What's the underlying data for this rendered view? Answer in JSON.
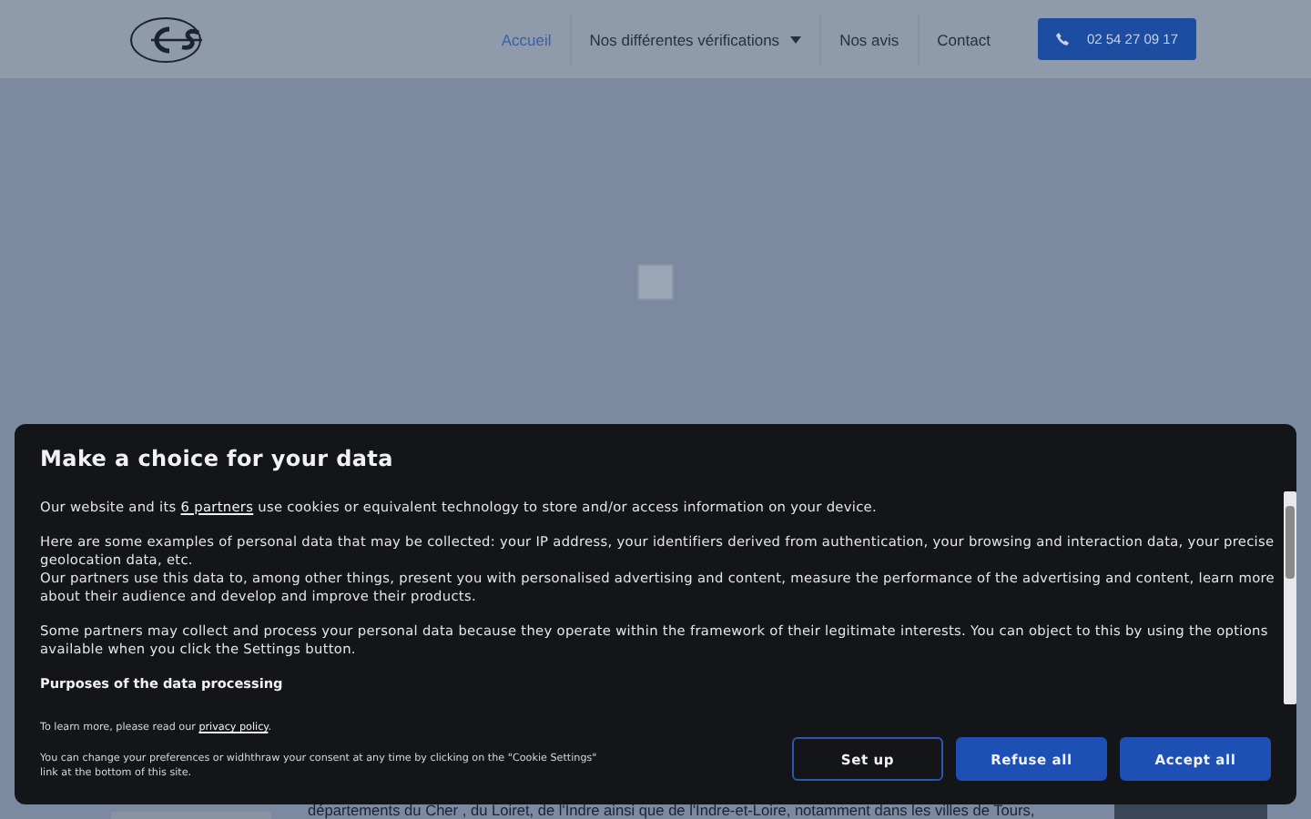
{
  "header": {
    "nav": [
      {
        "label": "Accueil",
        "selected": true,
        "dropdown": false
      },
      {
        "label": "Nos différentes vérifications",
        "selected": false,
        "dropdown": true
      },
      {
        "label": "Nos avis",
        "selected": false,
        "dropdown": false
      },
      {
        "label": "Contact",
        "selected": false,
        "dropdown": false
      }
    ],
    "phone_button": "02 54 27 09 17"
  },
  "page": {
    "bottom_text": "départements du Cher , du Loiret, de l'Indre ainsi que de l'Indre-et-Loire, notamment dans les villes de Tours,"
  },
  "consent_dialog": {
    "title": "Make a choice for your data",
    "intro": {
      "before": "Our website and its",
      "link": "6 partners",
      "after": "use cookies or equivalent technology to store and/or access information on your device."
    },
    "paragraphs": [
      "Here are some examples of personal data that may be collected: your IP address, your identifiers derived from authentication, your browsing and interaction data, your precise geolocation data, etc.",
      "Our partners use this data to, among other things, present you with personalised advertising and content, measure the performance of the advertising and content, learn more about their audience and develop and improve their products.",
      "Some partners may collect and process your personal data because they operate within the framework of their legitimate interests. You can object to this by using the options available when you click the Settings button."
    ],
    "section_heading": "Purposes of the data processing",
    "learn_more": {
      "before": "To learn more, please read our",
      "link": "privacy policy",
      "after": "."
    },
    "consent_note": "You can change your preferences or widhthraw your consent at any time by clicking on the \"Cookie Settings\" link at the bottom of this site.",
    "buttons": [
      {
        "label": "Set up",
        "kind": "outline"
      },
      {
        "label": "Refuse all",
        "kind": "filled"
      },
      {
        "label": "Accept all",
        "kind": "filled"
      }
    ]
  }
}
